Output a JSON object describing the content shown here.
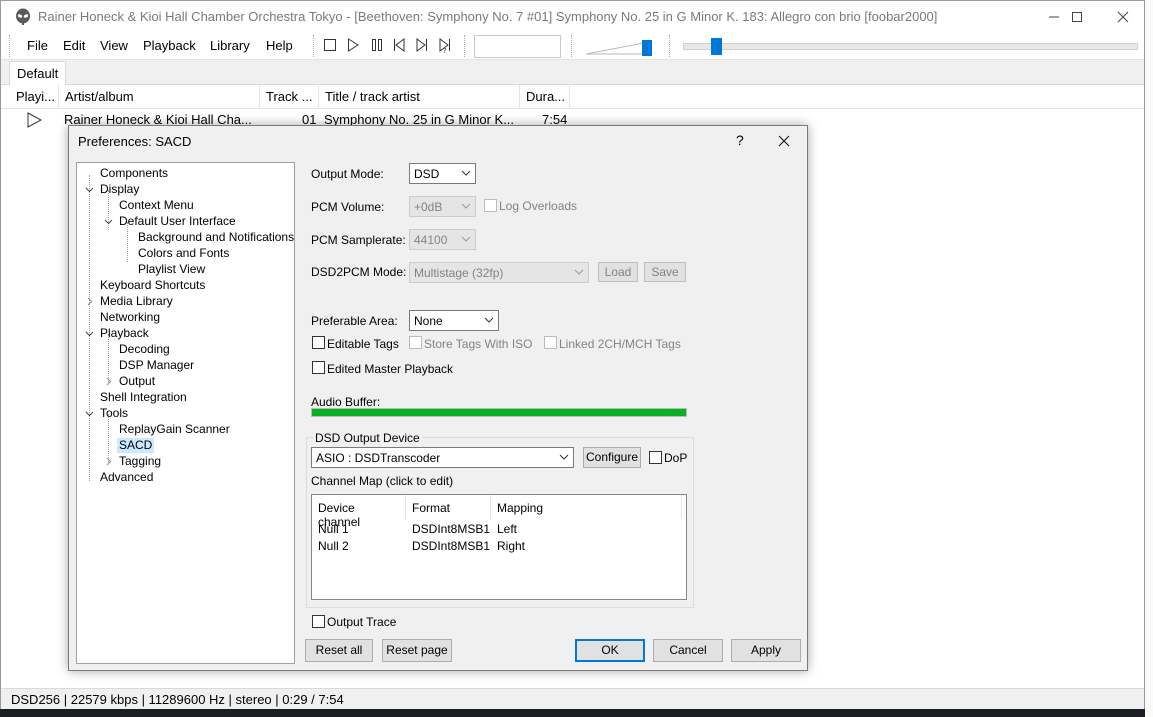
{
  "window": {
    "title": "Rainer Honeck & Kioi Hall Chamber Orchestra Tokyo - [Beethoven: Symphony No. 7 #01] Symphony No. 25 in G Minor K. 183: Allegro con brio  [foobar2000]",
    "app_icon": "alien-head-icon"
  },
  "menu": {
    "items": [
      "File",
      "Edit",
      "View",
      "Playback",
      "Library",
      "Help"
    ]
  },
  "toolbar": {
    "buttons": [
      "stop-icon",
      "play-icon",
      "pause-icon",
      "previous-icon",
      "next-icon",
      "random-icon"
    ],
    "volume_level": 0.9,
    "seek_position": 0.06
  },
  "tabs": [
    "Default"
  ],
  "playlist": {
    "columns": [
      "Playi...",
      "Artist/album",
      "Track ...",
      "Title / track artist",
      "Dura..."
    ],
    "rows": [
      {
        "artist_album": "Rainer Honeck & Kioi Hall Cha...",
        "track": "01",
        "title": "Symphony No. 25 in G Minor K...",
        "duration": "7:54"
      }
    ]
  },
  "status": {
    "text": "DSD256 | 22579 kbps | 11289600 Hz | stereo | 0:29 / 7:54"
  },
  "dialog": {
    "title": "Preferences: SACD",
    "help": "?",
    "tree": [
      "Components",
      "Display",
      "Context Menu",
      "Default User Interface",
      "Background and Notifications",
      "Colors and Fonts",
      "Playlist View",
      "Keyboard Shortcuts",
      "Media Library",
      "Networking",
      "Playback",
      "Decoding",
      "DSP Manager",
      "Output",
      "Shell Integration",
      "Tools",
      "ReplayGain Scanner",
      "SACD",
      "Tagging",
      "Advanced"
    ],
    "output_mode": {
      "label": "Output Mode:",
      "value": "DSD"
    },
    "pcm_volume": {
      "label": "PCM Volume:",
      "value": "+0dB"
    },
    "log_overloads": "Log Overloads",
    "pcm_samplerate": {
      "label": "PCM Samplerate:",
      "value": "44100"
    },
    "dsd2pcm_mode": {
      "label": "DSD2PCM Mode:",
      "value": "Multistage (32fp)"
    },
    "load_label": "Load",
    "save_label": "Save",
    "preferable_area": {
      "label": "Preferable Area:",
      "value": "None"
    },
    "editable_tags": "Editable Tags",
    "store_tags_iso": "Store Tags With ISO",
    "linked_tags": "Linked 2CH/MCH Tags",
    "edited_master": "Edited Master Playback",
    "audio_buffer": {
      "label": "Audio Buffer:",
      "level": 1.0
    },
    "dsd_output_device": {
      "title": "DSD Output Device",
      "device": "ASIO : DSDTranscoder",
      "configure_label": "Configure",
      "dop_label": "DoP",
      "channel_map_label": "Channel Map (click to edit)",
      "columns": [
        "Device channel",
        "Format",
        "Mapping"
      ],
      "rows": [
        {
          "channel": "Null 1",
          "format": "DSDInt8MSB1",
          "mapping": "Left"
        },
        {
          "channel": "Null 2",
          "format": "DSDInt8MSB1",
          "mapping": "Right"
        }
      ]
    },
    "output_trace": "Output Trace",
    "buttons": {
      "reset_all": "Reset all",
      "reset_page": "Reset page",
      "ok": "OK",
      "cancel": "Cancel",
      "apply": "Apply"
    },
    "colors": {
      "accent": "#0078d7",
      "buffer_fill": "#06b025",
      "selection": "#cce8ff"
    }
  }
}
